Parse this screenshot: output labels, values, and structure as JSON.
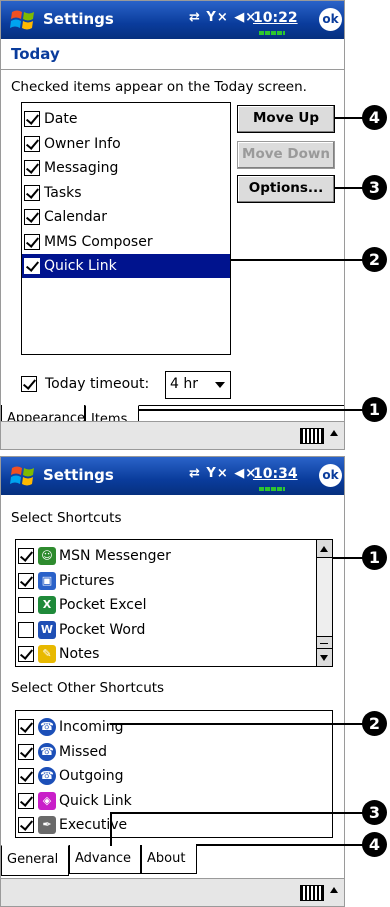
{
  "screen1": {
    "title": "Settings",
    "status_icons": "⇄ Y× ◀×",
    "time": "10:22",
    "ok_label": "ok",
    "page_heading": "Today",
    "instructions": "Checked items appear on the Today screen.",
    "items": [
      {
        "label": "Date",
        "checked": true,
        "selected": false
      },
      {
        "label": "Owner Info",
        "checked": true,
        "selected": false
      },
      {
        "label": "Messaging",
        "checked": true,
        "selected": false
      },
      {
        "label": "Tasks",
        "checked": true,
        "selected": false
      },
      {
        "label": "Calendar",
        "checked": true,
        "selected": false
      },
      {
        "label": "MMS Composer",
        "checked": true,
        "selected": false
      },
      {
        "label": "Quick Link",
        "checked": true,
        "selected": true
      }
    ],
    "buttons": {
      "move_up": "Move Up",
      "move_down": "Move Down",
      "options": "Options..."
    },
    "timeout_label": "Today timeout:",
    "timeout_value": "4 hr",
    "tabs": [
      "Appearance",
      "Items"
    ],
    "active_tab": "Items",
    "callouts": [
      "4",
      "3",
      "2",
      "1"
    ]
  },
  "screen2": {
    "title": "Settings",
    "status_icons": "⇄ Y× ◀×",
    "time": "10:34",
    "ok_label": "ok",
    "section1": "Select Shortcuts",
    "shortcuts": [
      {
        "label": "MSN Messenger",
        "checked": true,
        "icon": "msn-messenger-icon"
      },
      {
        "label": "Pictures",
        "checked": true,
        "icon": "pictures-icon"
      },
      {
        "label": "Pocket Excel",
        "checked": false,
        "icon": "excel-icon"
      },
      {
        "label": "Pocket Word",
        "checked": false,
        "icon": "word-icon"
      },
      {
        "label": "Notes",
        "checked": true,
        "icon": "notes-icon"
      }
    ],
    "section2": "Select Other Shortcuts",
    "other_shortcuts": [
      {
        "label": "Incoming",
        "checked": true,
        "icon": "incoming-call-icon"
      },
      {
        "label": "Missed",
        "checked": true,
        "icon": "missed-call-icon"
      },
      {
        "label": "Outgoing",
        "checked": true,
        "icon": "outgoing-call-icon"
      },
      {
        "label": "Quick Link",
        "checked": true,
        "icon": "quick-link-icon"
      },
      {
        "label": "Executive",
        "checked": true,
        "icon": "executive-icon"
      }
    ],
    "tabs": [
      "General",
      "Advance",
      "About"
    ],
    "active_tab": "General",
    "callouts": [
      "1",
      "2",
      "3",
      "4"
    ]
  },
  "colors": {
    "titlebar": "#0a3c9c",
    "selection": "#00138e",
    "heading": "#0a3c9c"
  }
}
